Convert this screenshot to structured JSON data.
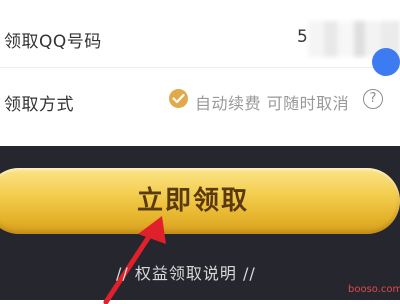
{
  "form": {
    "qq_label": "领取QQ号码",
    "qq_value": "5",
    "method_label": "领取方式",
    "method_text": "自动续费 可随时取消",
    "help_glyph": "?"
  },
  "cta": {
    "claim_label": "立即领取",
    "info_link": "// 权益领取说明 //"
  },
  "watermark": "booso.com",
  "colors": {
    "accent_blue": "#3d7bf2",
    "check_gold": "#e0a94a",
    "dark_bg": "#26262f",
    "button_gold": "#f3cd4e",
    "arrow_red": "#e0202a"
  },
  "icons": {
    "check": "check-circle-icon",
    "help": "question-circle-icon",
    "pointer": "red-arrow-icon"
  }
}
